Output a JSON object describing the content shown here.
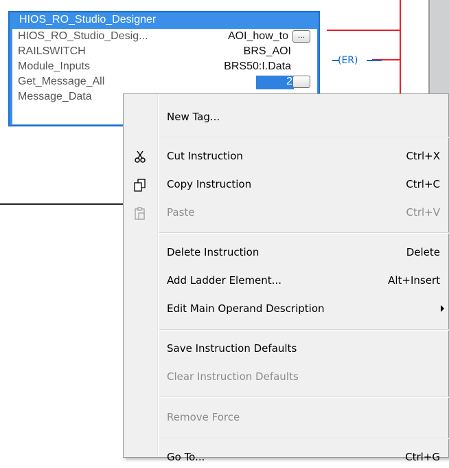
{
  "aoi": {
    "title": "HIOS_RO_Studio_Designer",
    "rows": [
      {
        "label": "HIOS_RO_Studio_Desig...",
        "value": "AOI_how_to"
      },
      {
        "label": "RAILSWITCH",
        "value": "BRS_AOI"
      },
      {
        "label": "Module_Inputs",
        "value": "BRS50:I.Data"
      },
      {
        "label": "Get_Message_All",
        "value": "2"
      },
      {
        "label": "Message_Data",
        "value": ""
      }
    ],
    "ellipsis": "..."
  },
  "coil": {
    "text": "(ER)"
  },
  "menu": {
    "items": [
      {
        "label": "New Tag...",
        "shortcut": ""
      },
      {
        "label": "Cut Instruction",
        "shortcut": "Ctrl+X"
      },
      {
        "label": "Copy Instruction",
        "shortcut": "Ctrl+C"
      },
      {
        "label": "Paste",
        "shortcut": "Ctrl+V"
      },
      {
        "label": "Delete Instruction",
        "shortcut": "Delete"
      },
      {
        "label": "Add Ladder Element...",
        "shortcut": "Alt+Insert"
      },
      {
        "label": "Edit Main Operand Description",
        "shortcut": ""
      },
      {
        "label": "Save Instruction Defaults",
        "shortcut": ""
      },
      {
        "label": "Clear Instruction Defaults",
        "shortcut": ""
      },
      {
        "label": "Remove Force",
        "shortcut": ""
      },
      {
        "label": "Go To...",
        "shortcut": "Ctrl+G"
      }
    ]
  },
  "colors": {
    "accent": "#3a8fe8",
    "rail": "#e8202a",
    "coil": "#0a66d8",
    "disabled_text": "#8c8c8c"
  }
}
